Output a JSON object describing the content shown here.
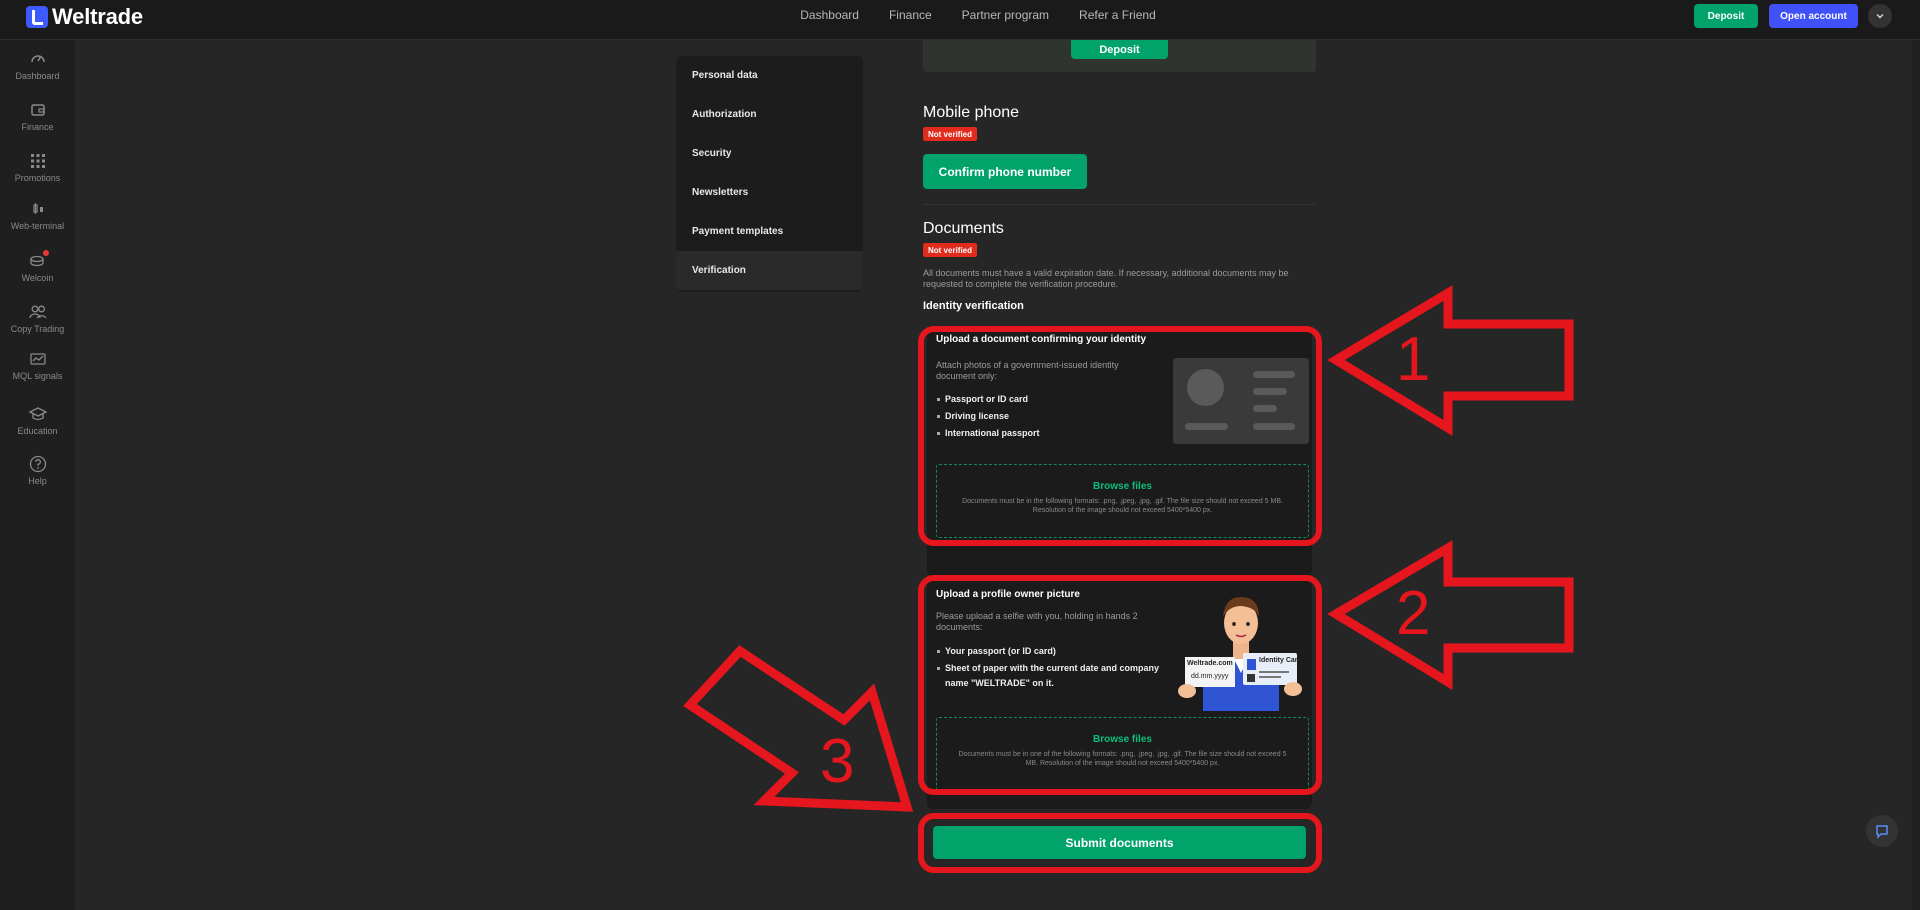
{
  "brand": {
    "name": "Weltrade"
  },
  "topnav": {
    "items": [
      "Dashboard",
      "Finance",
      "Partner program",
      "Refer a Friend"
    ]
  },
  "header": {
    "deposit_label": "Deposit",
    "open_account_label": "Open account"
  },
  "sidebar": {
    "items": [
      {
        "label": "Dashboard",
        "icon": "dashboard-icon"
      },
      {
        "label": "Finance",
        "icon": "wallet-icon"
      },
      {
        "label": "Promotions",
        "icon": "grid-icon"
      },
      {
        "label": "Web-terminal",
        "icon": "candles-icon"
      },
      {
        "label": "Welcoin",
        "icon": "coins-icon"
      },
      {
        "label": "Copy Trading",
        "icon": "users-icon"
      },
      {
        "label": "MQL signals",
        "icon": "signals-icon"
      },
      {
        "label": "Education",
        "icon": "graduation-icon"
      },
      {
        "label": "Help",
        "icon": "help-icon"
      }
    ]
  },
  "settings_menu": {
    "items": [
      "Personal data",
      "Authorization",
      "Security",
      "Newsletters",
      "Payment templates",
      "Verification"
    ],
    "active": "Verification"
  },
  "deposit_section": {
    "button_label": "Deposit"
  },
  "mobile_phone": {
    "title": "Mobile phone",
    "status": "Not verified",
    "button_label": "Confirm phone number"
  },
  "documents": {
    "title": "Documents",
    "status": "Not verified",
    "note": "All documents must have a valid expiration date. If necessary, additional documents may be requested to complete the verification procedure.",
    "identity_title": "Identity verification",
    "identity_card": {
      "title": "Upload a document confirming your identity",
      "description": "Attach photos of a government-issued identity document only:",
      "items": [
        "Passport or ID card",
        "Driving license",
        "International passport"
      ],
      "browse_label": "Browse files",
      "formats_note": "Documents must be in the following formats: .png, .jpeg, .jpg, .gif. The file size should not exceed 5 MB. Resolution of the image should not exceed 5400*5400 px."
    },
    "selfie_card": {
      "title": "Upload a profile owner picture",
      "description": "Please upload a selfie with you, holding in hands 2 documents:",
      "items": [
        "Your passport (or ID card)",
        "Sheet of paper with the current date and company name \"WELTRADE\" on it."
      ],
      "browse_label": "Browse files",
      "formats_note": "Documents must be in one of the following formats: .png, .jpeg, .jpg, .gif. The file size should not exceed 5 MB. Resolution of the image should not exceed 5400*5400 px.",
      "paper_text_1": "Weltrade.com",
      "paper_text_2": "dd.mm.yyyy",
      "id_card_text": "Identity Card"
    },
    "submit_label": "Submit documents"
  },
  "annotations": {
    "labels": [
      "1",
      "2",
      "3"
    ],
    "color": "#e5161d"
  },
  "colors": {
    "accent_green": "#01a36b",
    "accent_blue": "#3f51f7",
    "badge_red": "#e02b1d"
  }
}
